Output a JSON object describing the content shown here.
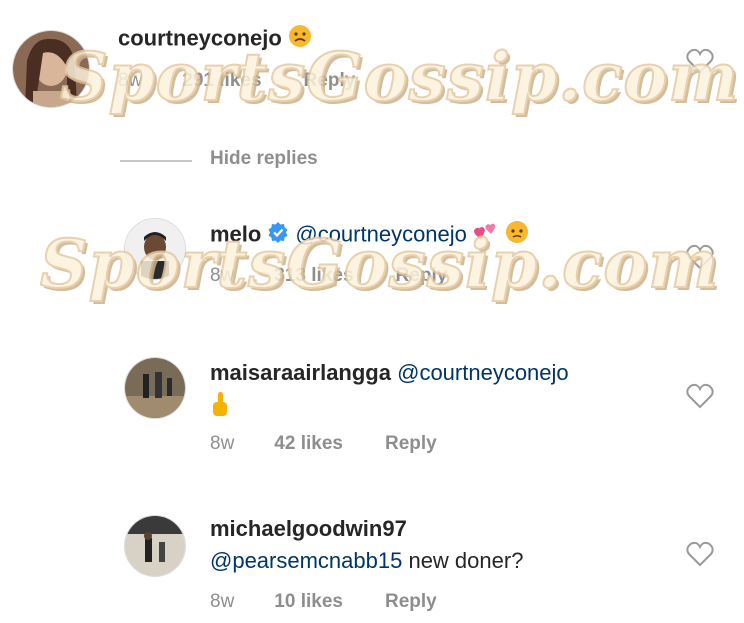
{
  "comments": [
    {
      "username": "courtneyconejo",
      "text": "",
      "age": "8w",
      "likes": "291 likes",
      "reply": "Reply"
    },
    {
      "username": "melo",
      "text": "@courtneyconejo",
      "age": "8w",
      "likes": "313 likes",
      "reply": "Reply"
    },
    {
      "username": "maisaraairlangga",
      "text": "@courtneyconejo",
      "age": "8w",
      "likes": "42 likes",
      "reply": "Reply"
    },
    {
      "username": "michaelgoodwin97",
      "mention": "@pearsemcnabb15",
      "text": " new doner?",
      "age": "8w",
      "likes": "10 likes",
      "reply": "Reply"
    }
  ],
  "hide_replies": "Hide replies",
  "watermark": "SportsGossip.com",
  "colors": {
    "mention": "#003569",
    "meta": "#8e8e8e",
    "verified": "#3897f0"
  },
  "icons": [
    "heart-outline-icon",
    "verified-badge-icon",
    "emoji-face-icon",
    "two-hearts-icon",
    "middle-finger-emoji-icon"
  ]
}
